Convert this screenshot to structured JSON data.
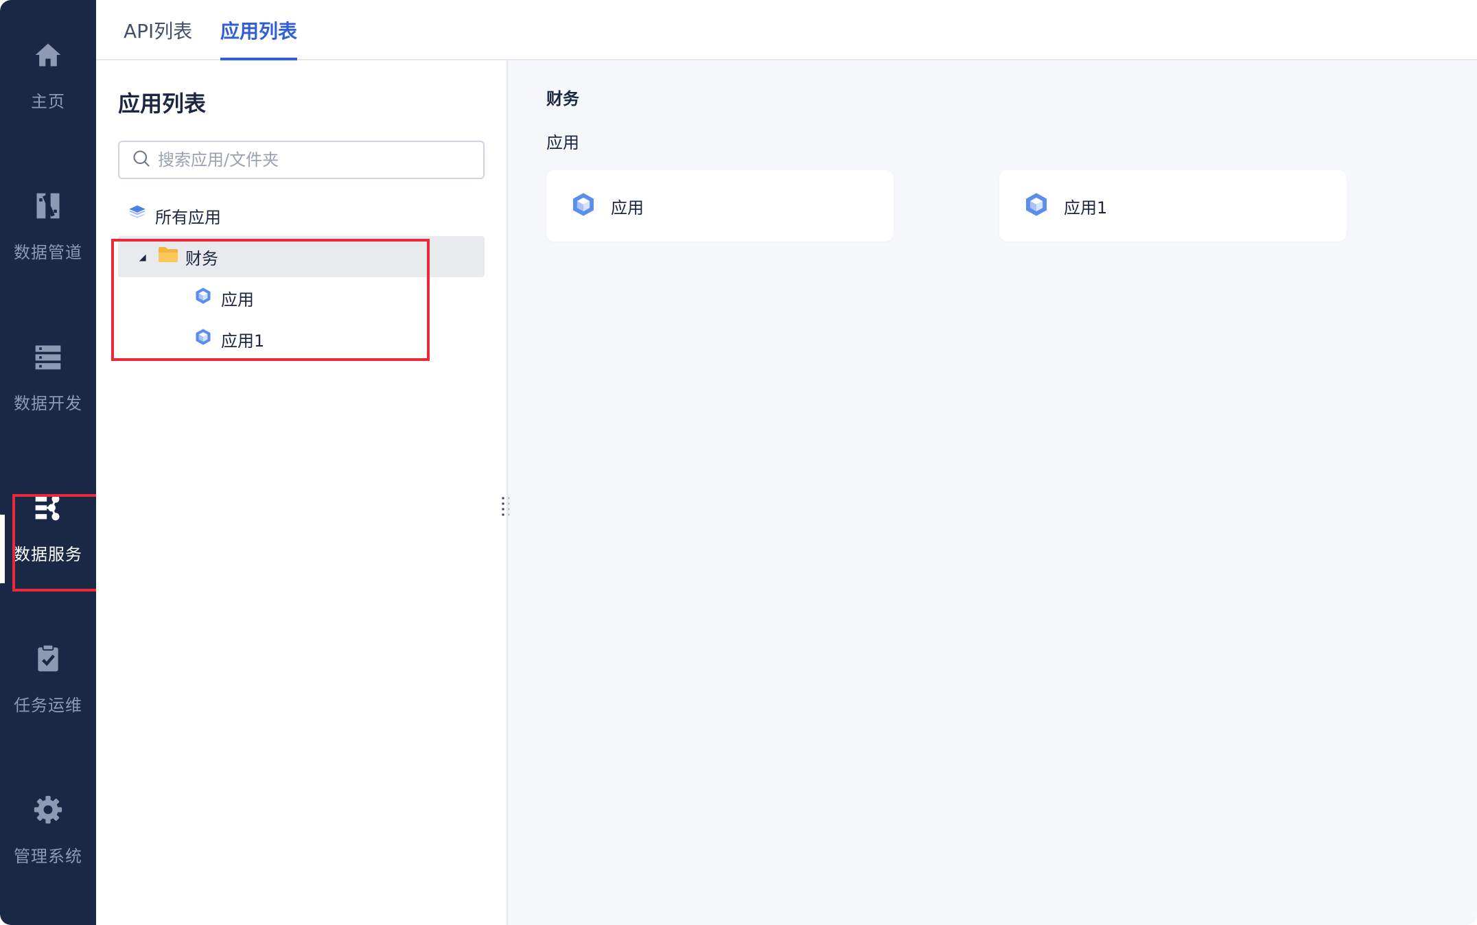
{
  "sidebar": {
    "items": [
      {
        "label": "主页",
        "icon": "home-icon"
      },
      {
        "label": "数据管道",
        "icon": "data-pipeline-icon"
      },
      {
        "label": "数据开发",
        "icon": "data-development-icon"
      },
      {
        "label": "数据服务",
        "icon": "data-service-icon",
        "active": true
      },
      {
        "label": "任务运维",
        "icon": "task-ops-icon"
      },
      {
        "label": "管理系统",
        "icon": "gear-icon"
      }
    ]
  },
  "tabs": [
    {
      "label": "API列表",
      "active": false
    },
    {
      "label": "应用列表",
      "active": true
    }
  ],
  "left_panel": {
    "title": "应用列表",
    "search_placeholder": "搜索应用/文件夹",
    "tree": {
      "root": {
        "label": "所有应用",
        "icon": "layers-icon"
      },
      "folder": {
        "label": "财务",
        "icon": "folder-icon",
        "expanded": true,
        "selected": true
      },
      "children": [
        {
          "label": "应用",
          "icon": "app-cube-icon"
        },
        {
          "label": "应用1",
          "icon": "app-cube-icon"
        }
      ]
    }
  },
  "content": {
    "breadcrumb": "财务",
    "section_label": "应用",
    "cards": [
      {
        "label": "应用",
        "icon": "app-cube-icon"
      },
      {
        "label": "应用1",
        "icon": "app-cube-icon"
      }
    ]
  },
  "colors": {
    "sidebar_bg": "#1a2845",
    "accent": "#2f5fd6",
    "highlight_box": "#ea2a38",
    "folder": "#f5a623",
    "cube": "#5b8def"
  }
}
